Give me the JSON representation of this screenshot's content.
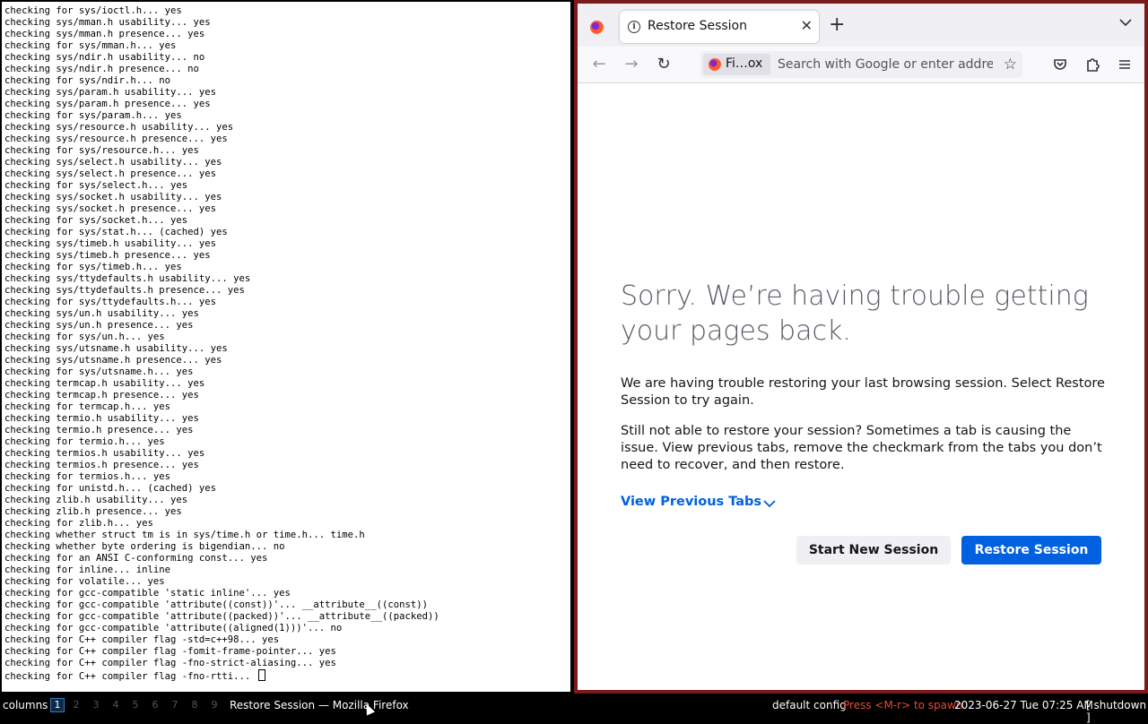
{
  "terminal": {
    "lines": [
      "checking for sys/ioctl.h... yes",
      "checking sys/mman.h usability... yes",
      "checking sys/mman.h presence... yes",
      "checking for sys/mman.h... yes",
      "checking sys/ndir.h usability... no",
      "checking sys/ndir.h presence... no",
      "checking for sys/ndir.h... no",
      "checking sys/param.h usability... yes",
      "checking sys/param.h presence... yes",
      "checking for sys/param.h... yes",
      "checking sys/resource.h usability... yes",
      "checking sys/resource.h presence... yes",
      "checking for sys/resource.h... yes",
      "checking sys/select.h usability... yes",
      "checking sys/select.h presence... yes",
      "checking for sys/select.h... yes",
      "checking sys/socket.h usability... yes",
      "checking sys/socket.h presence... yes",
      "checking for sys/socket.h... yes",
      "checking for sys/stat.h... (cached) yes",
      "checking sys/timeb.h usability... yes",
      "checking sys/timeb.h presence... yes",
      "checking for sys/timeb.h... yes",
      "checking sys/ttydefaults.h usability... yes",
      "checking sys/ttydefaults.h presence... yes",
      "checking for sys/ttydefaults.h... yes",
      "checking sys/un.h usability... yes",
      "checking sys/un.h presence... yes",
      "checking for sys/un.h... yes",
      "checking sys/utsname.h usability... yes",
      "checking sys/utsname.h presence... yes",
      "checking for sys/utsname.h... yes",
      "checking termcap.h usability... yes",
      "checking termcap.h presence... yes",
      "checking for termcap.h... yes",
      "checking termio.h usability... yes",
      "checking termio.h presence... yes",
      "checking for termio.h... yes",
      "checking termios.h usability... yes",
      "checking termios.h presence... yes",
      "checking for termios.h... yes",
      "checking for unistd.h... (cached) yes",
      "checking zlib.h usability... yes",
      "checking zlib.h presence... yes",
      "checking for zlib.h... yes",
      "checking whether struct tm is in sys/time.h or time.h... time.h",
      "checking whether byte ordering is bigendian... no",
      "checking for an ANSI C-conforming const... yes",
      "checking for inline... inline",
      "checking for volatile... yes",
      "checking for gcc-compatible 'static inline'... yes",
      "checking for gcc-compatible 'attribute((const))'... __attribute__((const))",
      "checking for gcc-compatible 'attribute((packed))'... __attribute__((packed))",
      "checking for gcc-compatible 'attribute((aligned(1)))'... no",
      "checking for C++ compiler flag -std=c++98... yes",
      "checking for C++ compiler flag -fomit-frame-pointer... yes",
      "checking for C++ compiler flag -fno-strict-aliasing... yes",
      "checking for C++ compiler flag -fno-rtti... "
    ]
  },
  "browser": {
    "tab_title": "Restore Session",
    "tab_close": "✕",
    "new_tab": "+",
    "identity_label": "Fi…ox",
    "url_placeholder": "Search with Google or enter address",
    "error_title": "Sorry. We’re having trouble getting your pages back.",
    "para1": "We are having trouble restoring your last browsing session. Select Restore Session to try again.",
    "para2": "Still not able to restore your session? Sometimes a tab is causing the issue. View previous tabs, remove the checkmark from the tabs you don’t need to recover, and then restore.",
    "view_previous": "View Previous Tabs",
    "start_new_session": "Start New Session",
    "restore_session": "Restore Session",
    "colors": {
      "accent": "#0061e0",
      "frame": "#7b1a1a"
    }
  },
  "statusbar": {
    "layout": "columns",
    "workspaces": [
      "1",
      "2",
      "3",
      "4",
      "5",
      "6",
      "7",
      "8",
      "9"
    ],
    "active_workspace": "1",
    "window_title": "Restore Session — Mozilla Firefox",
    "config": "default config",
    "spawn_hint": "Press <M-r> to spawn",
    "datetime": "2023-06-27 Tue 07:25 AM",
    "shutdown": "[ shutdown ]"
  }
}
